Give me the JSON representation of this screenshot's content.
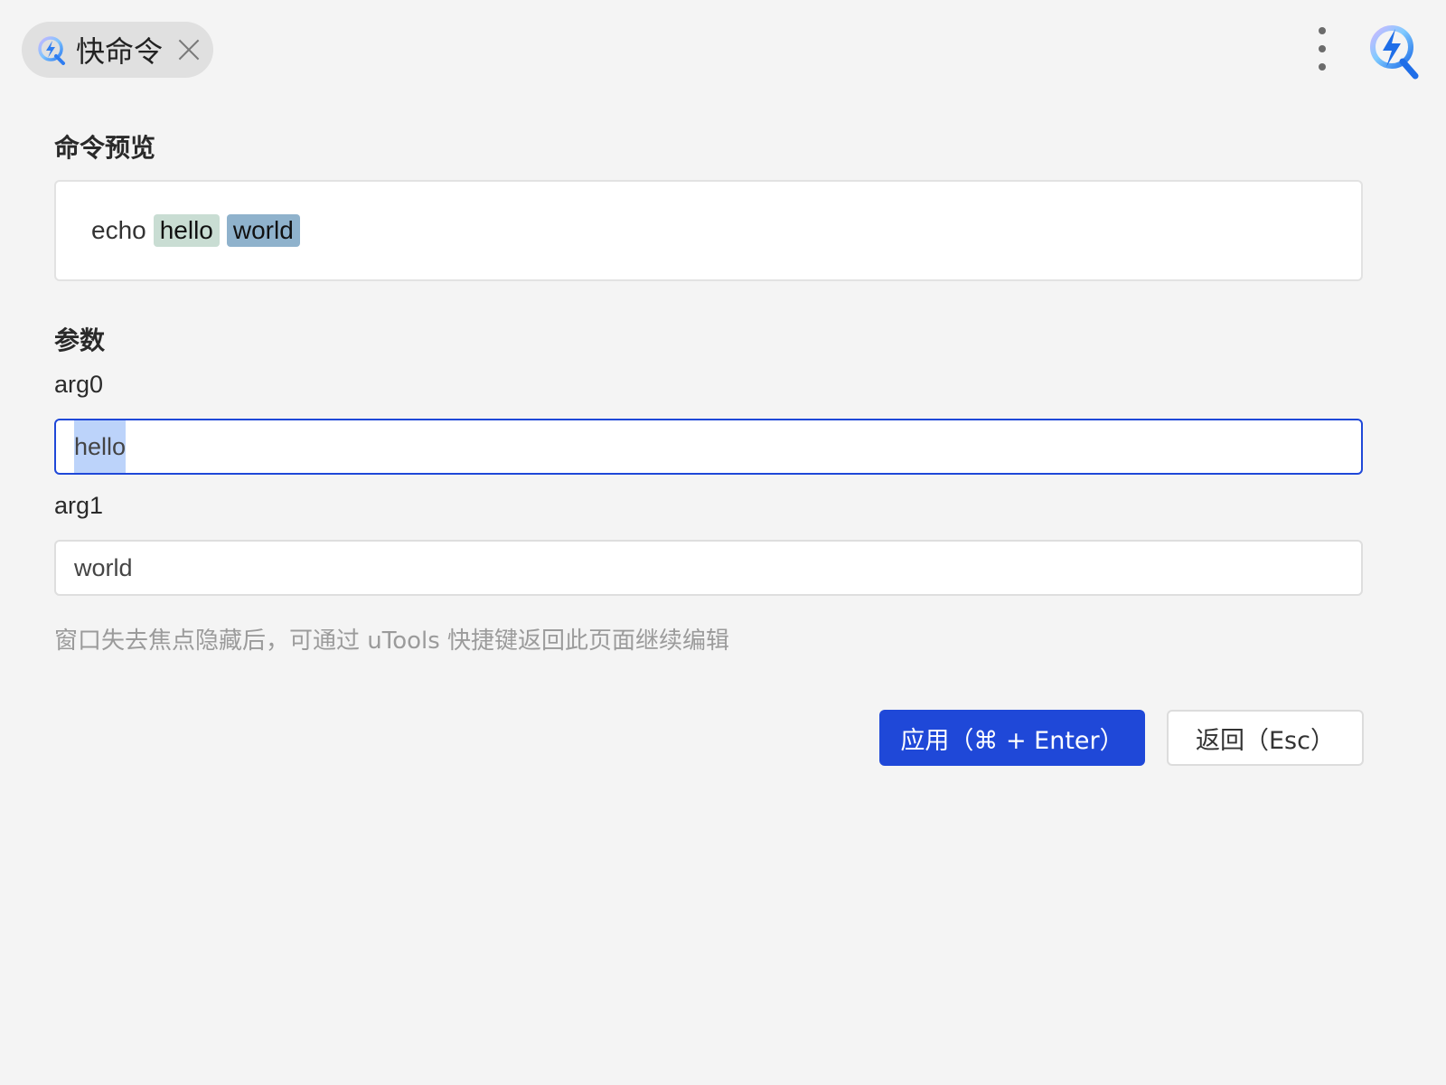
{
  "header": {
    "tag_label": "快命令",
    "tag_icon": "utools-bolt-logo-icon",
    "close_icon": "close-icon",
    "menu_icon": "more-vertical-icon",
    "app_icon": "utools-bolt-logo-icon"
  },
  "preview": {
    "title": "命令预览",
    "command": "echo",
    "args": [
      "hello",
      "world"
    ]
  },
  "params": {
    "title": "参数",
    "fields": [
      {
        "label": "arg0",
        "value": "hello",
        "focused": true,
        "selected": true
      },
      {
        "label": "arg1",
        "value": "world",
        "focused": false,
        "selected": false
      }
    ]
  },
  "hint": "窗口失去焦点隐藏后，可通过 uTools 快捷键返回此页面继续编辑",
  "buttons": {
    "apply_label": "应用（⌘ + Enter）",
    "back_label": "返回（Esc）"
  },
  "colors": {
    "accent": "#1f48d8",
    "arg0_highlight": "#c9ddd3",
    "arg1_highlight": "#8fb2cc",
    "selection": "#bcd3fa",
    "background": "#f4f4f4"
  }
}
